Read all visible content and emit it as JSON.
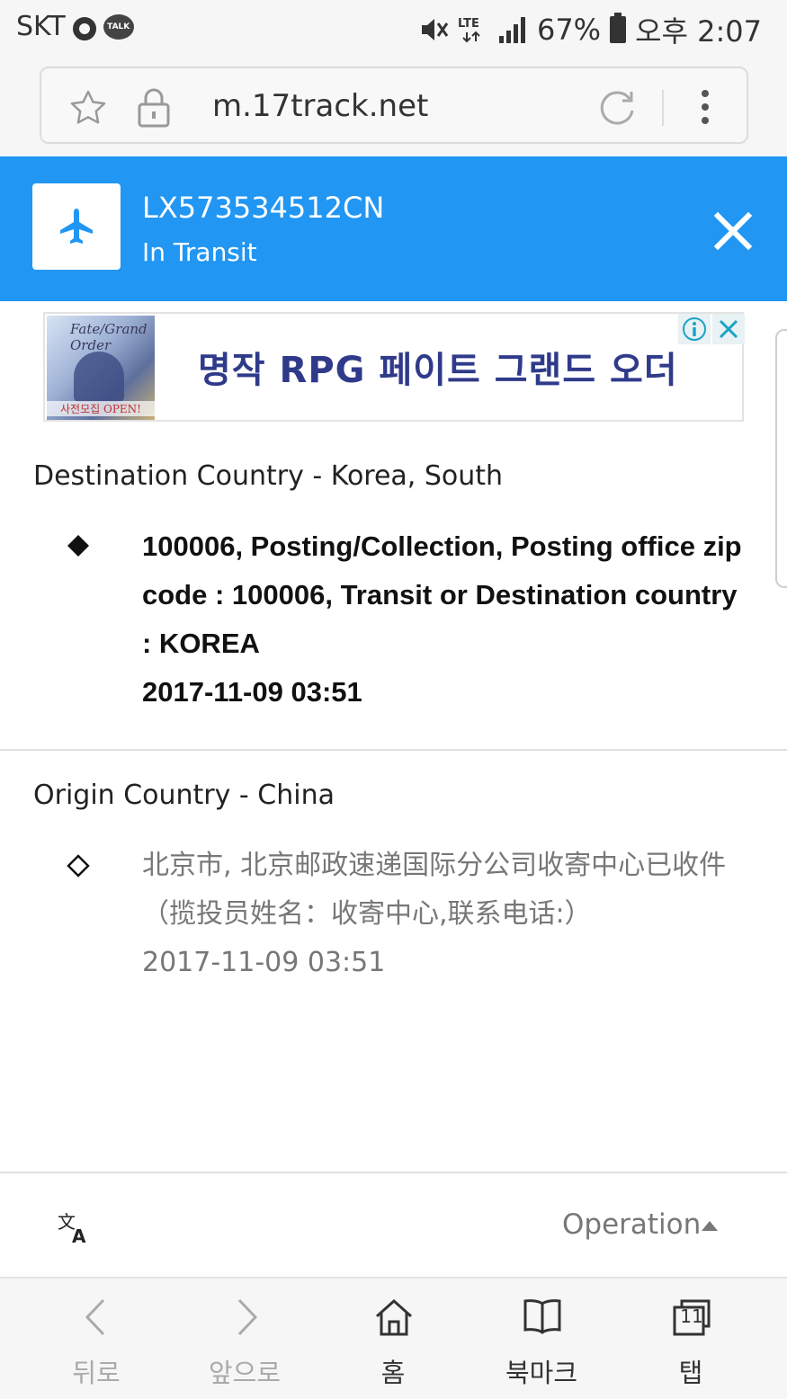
{
  "status_bar": {
    "carrier": "SKT",
    "battery": "67%",
    "time": "오후 2:07",
    "network": "LTE"
  },
  "browser": {
    "url": "m.17track.net"
  },
  "tracking": {
    "number": "LX573534512CN",
    "status": "In Transit",
    "accent_color": "#2196f3"
  },
  "ad": {
    "headline": "명작 RPG 페이트 그랜드 오더",
    "logo_text": "Fate/Grand Order",
    "cta_text": "사전모집 OPEN!"
  },
  "destination": {
    "title": "Destination Country - Korea, South",
    "event_text": "100006, Posting/Collection, Posting office zip code : 100006, Transit or Destination country : KOREA",
    "event_time": "2017-11-09 03:51"
  },
  "origin": {
    "title": "Origin Country - China",
    "event_text": "北京市, 北京邮政速递国际分公司收寄中心已收件（揽投员姓名：收寄中心,联系电话:）",
    "event_time": "2017-11-09 03:51"
  },
  "operation_bar": {
    "label": "Operation"
  },
  "browser_nav": {
    "back": "뒤로",
    "forward": "앞으로",
    "home": "홈",
    "bookmarks": "북마크",
    "tabs": "탭",
    "tab_count": "11"
  }
}
